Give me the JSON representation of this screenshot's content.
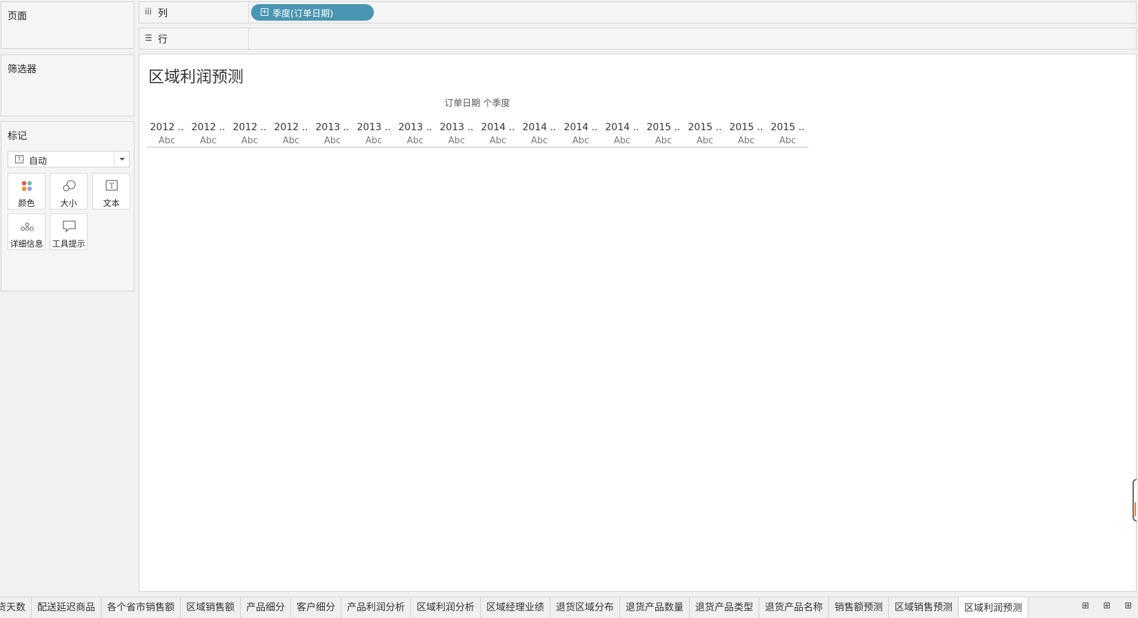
{
  "pages_card": {
    "title": "页面"
  },
  "filters_card": {
    "title": "筛选器"
  },
  "marks_card": {
    "title": "标记",
    "mark_type": {
      "selected": "自动",
      "icon": "text-mark-icon"
    },
    "buttons": [
      {
        "label": "颜色",
        "icon": "color-dots-icon"
      },
      {
        "label": "大小",
        "icon": "size-circles-icon"
      },
      {
        "label": "文本",
        "icon": "text-box-icon"
      },
      {
        "label": "详细信息",
        "icon": "detail-dots-icon"
      },
      {
        "label": "工具提示",
        "icon": "tooltip-bubble-icon"
      }
    ]
  },
  "shelves": {
    "columns": {
      "label": "列",
      "icon": "columns-icon",
      "pill": "季度(订单日期)"
    },
    "rows": {
      "label": "行",
      "icon": "rows-icon"
    }
  },
  "view": {
    "title": "区域利润预测",
    "column_header": "订单日期 个季度",
    "quarters": [
      "2012 ..",
      "2012 ..",
      "2012 ..",
      "2012 ..",
      "2013 ..",
      "2013 ..",
      "2013 ..",
      "2013 ..",
      "2014 ..",
      "2014 ..",
      "2014 ..",
      "2014 ..",
      "2015 ..",
      "2015 ..",
      "2015 ..",
      "2015 .."
    ],
    "cell_placeholder": "Abc"
  },
  "tabs": {
    "items": [
      "货天数",
      "配送延迟商品",
      "各个省市销售额",
      "区域销售额",
      "产品细分",
      "客户细分",
      "产品利润分析",
      "区域利润分析",
      "区域经理业绩",
      "退货区域分布",
      "退货产品数量",
      "退货产品类型",
      "退货产品名称",
      "销售额预测",
      "区域销售预测",
      "区域利润预测"
    ],
    "active": "区域利润预测",
    "tools": [
      "new-worksheet-icon",
      "new-dashboard-icon",
      "new-story-icon"
    ]
  },
  "colors": {
    "pill": "#4996b2",
    "accent": "#e8782b"
  }
}
